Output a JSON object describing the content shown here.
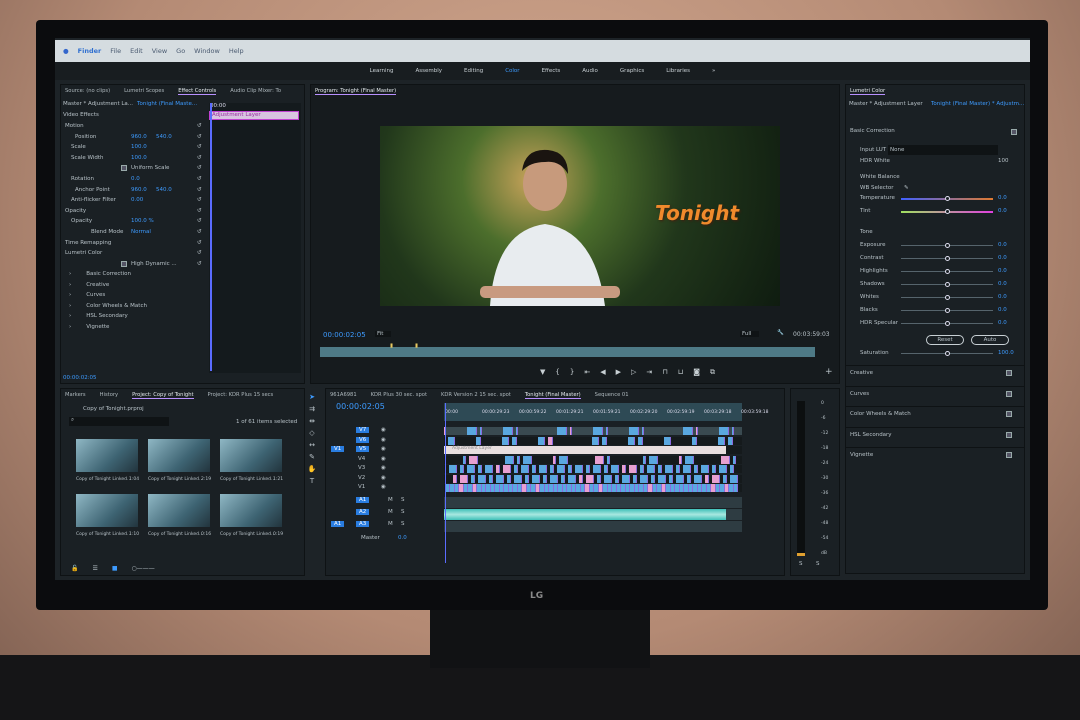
{
  "menubar": {
    "items": [
      "Finder",
      "File",
      "Edit",
      "View",
      "Go",
      "Window",
      "Help"
    ]
  },
  "workspaces": {
    "items": [
      "Learning",
      "Assembly",
      "Editing",
      "Color",
      "Effects",
      "Audio",
      "Graphics",
      "Libraries"
    ],
    "active": "Color",
    "more": "»"
  },
  "left_panel": {
    "tabs": [
      "Source: (no clips)",
      "Lumetri Scopes",
      "Effect Controls",
      "Audio Clip Mixer: To"
    ],
    "active": "Effect Controls",
    "master": "Master * Adjustment La...",
    "sequence": "Tonight (Final Maste...",
    "timecode_start": "00:00",
    "clip_label": "Adjustment Layer",
    "section": "Video Effects",
    "rows": [
      {
        "label": "Motion",
        "v1": "",
        "v2": ""
      },
      {
        "label": "Position",
        "v1": "960.0",
        "v2": "540.0"
      },
      {
        "label": "Scale",
        "v1": "100.0",
        "v2": ""
      },
      {
        "label": "Scale Width",
        "v1": "100.0",
        "v2": ""
      },
      {
        "label": "Uniform Scale",
        "v1": "",
        "v2": ""
      },
      {
        "label": "Rotation",
        "v1": "0.0",
        "v2": ""
      },
      {
        "label": "Anchor Point",
        "v1": "960.0",
        "v2": "540.0"
      },
      {
        "label": "Anti-flicker Filter",
        "v1": "0.00",
        "v2": ""
      },
      {
        "label": "Opacity",
        "v1": "",
        "v2": ""
      },
      {
        "label": "Opacity",
        "v1": "100.0 %",
        "v2": ""
      },
      {
        "label": "Blend Mode",
        "v1": "Normal",
        "v2": ""
      },
      {
        "label": "Time Remapping",
        "v1": "",
        "v2": ""
      },
      {
        "label": "Lumetri Color",
        "v1": "",
        "v2": ""
      },
      {
        "label": "High Dynamic ...",
        "v1": "",
        "v2": ""
      }
    ],
    "sub": [
      "Basic Correction",
      "Creative",
      "Curves",
      "Color Wheels & Match",
      "HSL Secondary",
      "Vignette"
    ],
    "footer_time": "00:00:02:05"
  },
  "program": {
    "title": "Program: Tonight (Final Master)",
    "overlay_text": "Tonight",
    "timecode": "00:00:02:05",
    "fit": "Fit",
    "quality": "Full",
    "duration": "00:03:59:03"
  },
  "lumetri": {
    "title": "Lumetri Color",
    "master": "Master * Adjustment Layer",
    "sequence": "Tonight (Final Master) * Adjustm...",
    "basic": "Basic Correction",
    "input_lut_label": "Input LUT",
    "input_lut": "None",
    "hdr_white_label": "HDR White",
    "hdr_white": "100",
    "wb": "White Balance",
    "wb_selector": "WB Selector",
    "sliders": [
      {
        "label": "Temperature",
        "value": "0.0"
      },
      {
        "label": "Tint",
        "value": "0.0"
      }
    ],
    "tone": "Tone",
    "tone_sliders": [
      {
        "label": "Exposure",
        "value": "0.0"
      },
      {
        "label": "Contrast",
        "value": "0.0"
      },
      {
        "label": "Highlights",
        "value": "0.0"
      },
      {
        "label": "Shadows",
        "value": "0.0"
      },
      {
        "label": "Whites",
        "value": "0.0"
      },
      {
        "label": "Blacks",
        "value": "0.0"
      },
      {
        "label": "HDR Specular",
        "value": "0.0"
      }
    ],
    "reset": "Reset",
    "auto": "Auto",
    "saturation_label": "Saturation",
    "saturation": "100.0",
    "sections": [
      "Creative",
      "Curves",
      "Color Wheels & Match",
      "HSL Secondary",
      "Vignette"
    ]
  },
  "project": {
    "tabs": [
      "Markers",
      "History",
      "Project: Copy of Tonight",
      "Project: KDR Plus 15 secs"
    ],
    "active": "Project: Copy of Tonight",
    "file": "Copy of Tonight.prproj",
    "selected": "1 of 61 items selected",
    "items": [
      {
        "name": "Copy of Tonight Linked...",
        "dur": "1:04"
      },
      {
        "name": "Copy of Tonight Linked...",
        "dur": "2:19"
      },
      {
        "name": "Copy of Tonight Linked...",
        "dur": "1:21"
      },
      {
        "name": "Copy of Tonight Linked...",
        "dur": "1:10"
      },
      {
        "name": "Copy of Tonight Linked...",
        "dur": "0:16"
      },
      {
        "name": "Copy of Tonight Linked...",
        "dur": "0:19"
      }
    ]
  },
  "timeline": {
    "tabs": [
      "961A6981",
      "KDR Plus 30 sec. spot",
      "KDR Version 2 15 sec. spot",
      "Tonight (Final Master)",
      "Sequence 01"
    ],
    "active": "Tonight (Final Master)",
    "timecode": "00:00:02:05",
    "ruler": [
      "00:00",
      "00:00:29:23",
      "00:00:59:22",
      "00:01:29:21",
      "00:01:59:21",
      "00:02:29:20",
      "00:02:59:19",
      "00:03:29:18",
      "00:03:59:18"
    ],
    "video_tracks": [
      "V7",
      "V6",
      "V5",
      "V4",
      "V3",
      "V2",
      "V1"
    ],
    "audio_tracks": [
      "A1",
      "A2",
      "A3"
    ],
    "source_v": "V1",
    "source_a": "A1",
    "adjustment_clip": "Adjustment Layer",
    "master": "Master",
    "master_val": "0.0",
    "m": "M",
    "s": "S"
  },
  "meter": {
    "scale": [
      "0",
      "-6",
      "-12",
      "-18",
      "-24",
      "-30",
      "-36",
      "-42",
      "-48",
      "-54",
      "dB"
    ],
    "s": "S"
  },
  "brand": {
    "logo": "LG"
  },
  "colors": {
    "accent": "#3d9bff",
    "tab_underline": "#b890ff",
    "video_clip": "#5aa8e0",
    "pink_clip": "#e8a0d0",
    "audio_clip": "#3fc0b8"
  }
}
